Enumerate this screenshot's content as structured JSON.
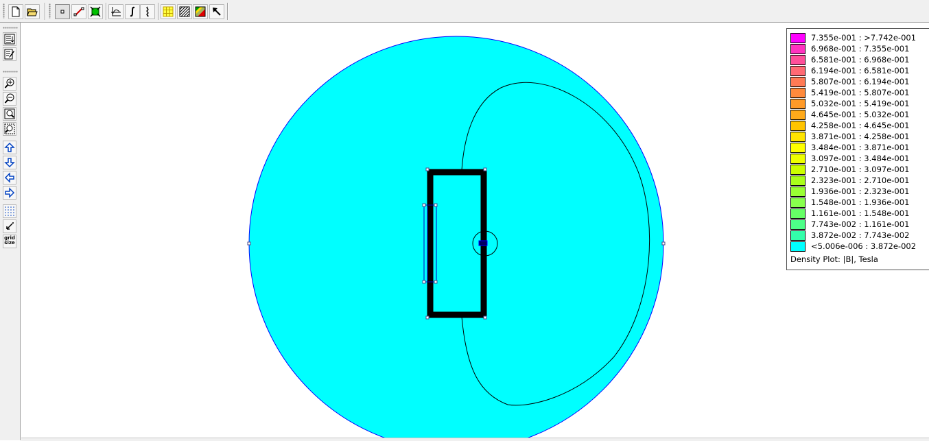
{
  "toolbar": {
    "buttons": [
      {
        "name": "new-file-button",
        "icon": "new-file-icon"
      },
      {
        "name": "open-file-button",
        "icon": "open-folder-icon"
      },
      {
        "name": "point-mode-button",
        "icon": "point-icon",
        "pressed": true
      },
      {
        "name": "line-mode-button",
        "icon": "line-icon"
      },
      {
        "name": "area-mode-button",
        "icon": "area-icon"
      },
      {
        "name": "plot-along-contour-button",
        "icon": "xy-plot-icon"
      },
      {
        "name": "integrate-button",
        "icon": "integral-icon"
      },
      {
        "name": "contour-plot-button",
        "icon": "contour-icon"
      },
      {
        "name": "vector-plot-button",
        "icon": "grid-yellow-icon"
      },
      {
        "name": "hatch-plot-button",
        "icon": "hatch-icon"
      },
      {
        "name": "density-plot-button",
        "icon": "density-icon"
      },
      {
        "name": "pointer-button",
        "icon": "arrow-pointer-icon"
      }
    ]
  },
  "sidebar": {
    "buttons": [
      {
        "name": "show-results-button",
        "icon": "list-icon"
      },
      {
        "name": "edit-button",
        "icon": "edit-pencil-icon"
      },
      {
        "name": "zoom-in-button",
        "icon": "zoom-in-icon"
      },
      {
        "name": "zoom-out-button",
        "icon": "zoom-out-icon"
      },
      {
        "name": "zoom-natural-button",
        "icon": "zoom-fit-icon"
      },
      {
        "name": "zoom-window-button",
        "icon": "zoom-window-icon"
      },
      {
        "name": "pan-up-button",
        "icon": "arrow-up-icon"
      },
      {
        "name": "pan-down-button",
        "icon": "arrow-down-icon"
      },
      {
        "name": "pan-left-button",
        "icon": "arrow-left-icon"
      },
      {
        "name": "pan-right-button",
        "icon": "arrow-right-icon"
      },
      {
        "name": "show-grid-button",
        "icon": "grid-dots-icon"
      },
      {
        "name": "snap-grid-button",
        "icon": "snap-icon"
      },
      {
        "name": "grid-size-button",
        "icon": "grid-size-icon",
        "label": "grid size"
      }
    ]
  },
  "plot": {
    "fill_color": "#00ffff",
    "contour_color": "#000000",
    "boundary_color": "#0000ff",
    "coil_color": "#000000"
  },
  "legend": {
    "caption": "Density Plot: |B|, Tesla",
    "entries": [
      {
        "label": "7.355e-001 : >7.742e-001",
        "color": "#ff00ff"
      },
      {
        "label": "6.968e-001 : 7.355e-001",
        "color": "#ff33c0"
      },
      {
        "label": "6.581e-001 : 6.968e-001",
        "color": "#ff4f9a"
      },
      {
        "label": "6.194e-001 : 6.581e-001",
        "color": "#ff6a74"
      },
      {
        "label": "5.807e-001 : 6.194e-001",
        "color": "#ff7a55"
      },
      {
        "label": "5.419e-001 : 5.807e-001",
        "color": "#ff8a3c"
      },
      {
        "label": "5.032e-001 : 5.419e-001",
        "color": "#ff9a28"
      },
      {
        "label": "4.645e-001 : 5.032e-001",
        "color": "#ffaa1a"
      },
      {
        "label": "4.258e-001 : 4.645e-001",
        "color": "#ffc400"
      },
      {
        "label": "3.871e-001 : 4.258e-001",
        "color": "#ffe400"
      },
      {
        "label": "3.484e-001 : 3.871e-001",
        "color": "#ffff00"
      },
      {
        "label": "3.097e-001 : 3.484e-001",
        "color": "#eeff00"
      },
      {
        "label": "2.710e-001 : 3.097e-001",
        "color": "#ccff00"
      },
      {
        "label": "2.323e-001 : 2.710e-001",
        "color": "#aaff1a"
      },
      {
        "label": "1.936e-001 : 2.323e-001",
        "color": "#99ff33"
      },
      {
        "label": "1.548e-001 : 1.936e-001",
        "color": "#88ff4d"
      },
      {
        "label": "1.161e-001 : 1.548e-001",
        "color": "#66ff66"
      },
      {
        "label": "7.743e-002 : 1.161e-001",
        "color": "#4dff88"
      },
      {
        "label": "3.872e-002 : 7.743e-002",
        "color": "#33ffaa"
      },
      {
        "label": "<5.006e-006 : 3.872e-002",
        "color": "#00ffff"
      }
    ]
  }
}
